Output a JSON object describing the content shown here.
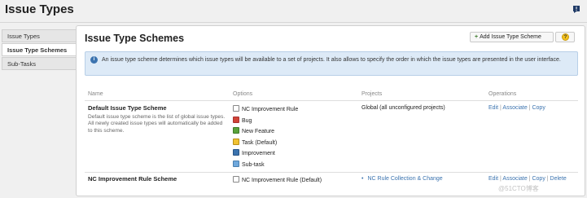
{
  "page": {
    "title": "Issue Types"
  },
  "sidebar": {
    "items": [
      {
        "label": "Issue Types"
      },
      {
        "label": "Issue Type Schemes"
      },
      {
        "label": "Sub-Tasks"
      }
    ]
  },
  "panel": {
    "title": "Issue Type Schemes",
    "add_button": "Add Issue Type Scheme",
    "info": "An issue type scheme determines which issue types will be available to a set of projects. It also allows to specify the order in which the issue types are presented in the user interface.",
    "columns": [
      "Name",
      "Options",
      "Projects",
      "Operations"
    ]
  },
  "schemes": [
    {
      "name": "Default Issue Type Scheme",
      "description": "Default issue type scheme is the list of global issue types. All newly created issue types will automatically be added to this scheme.",
      "options": [
        {
          "label": "NC Improvement Rule",
          "icon": "nc-improvement-icon",
          "color": "#ffffff"
        },
        {
          "label": "Bug",
          "icon": "bug-icon",
          "color": "#d04437"
        },
        {
          "label": "New Feature",
          "icon": "new-feature-icon",
          "color": "#59a33b"
        },
        {
          "label": "Task (Default)",
          "icon": "task-icon",
          "color": "#f1c232"
        },
        {
          "label": "Improvement",
          "icon": "improvement-icon",
          "color": "#3b73af"
        },
        {
          "label": "Sub-task",
          "icon": "subtask-icon",
          "color": "#6fa8dc"
        }
      ],
      "projects": "Global (all unconfigured projects)",
      "operations": [
        "Edit",
        "Associate",
        "Copy"
      ]
    },
    {
      "name": "NC Improvement Rule Scheme",
      "options": [
        {
          "label": "NC Improvement Rule (Default)",
          "icon": "nc-improvement-icon",
          "color": "#ffffff"
        }
      ],
      "projects": "NC Rule Collection & Change",
      "operations": [
        "Edit",
        "Associate",
        "Copy",
        "Delete"
      ]
    }
  ],
  "watermark": "@51CTO博客"
}
